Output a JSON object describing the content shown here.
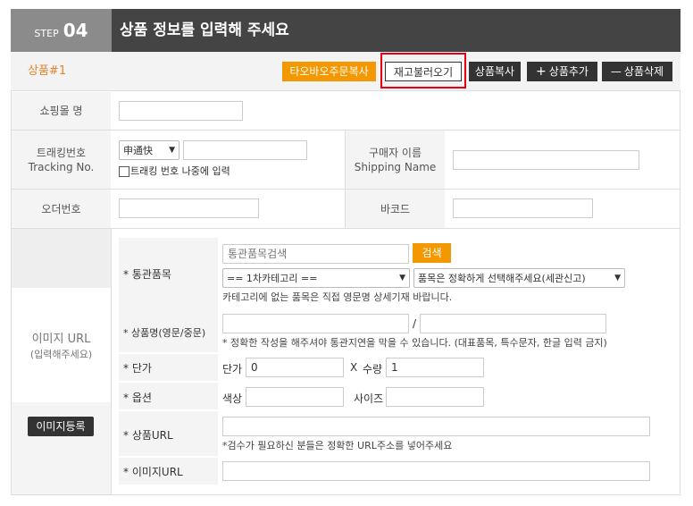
{
  "header": {
    "step_label": "STEP",
    "step_num": "04",
    "title": "상품 정보를 입력해 주세요"
  },
  "product": {
    "label": "상품#1",
    "buttons": {
      "taobao": "타오바오주문복사",
      "reload": "재고불러오기",
      "copy": "상품복사",
      "add": "상품추가",
      "delete": "상품삭제"
    },
    "add_icon": "+",
    "delete_icon": "—"
  },
  "form": {
    "mall_name": {
      "label": "쇼핑몰 명",
      "value": ""
    },
    "tracking": {
      "label_ko": "트래킹번호",
      "label_en": "Tracking No.",
      "carrier": "申通快",
      "value": "",
      "later_label": "트래킹 번호 나중에 입력"
    },
    "buyer": {
      "label_ko": "구매자 이름",
      "label_en": "Shipping Name",
      "value": ""
    },
    "order_no": {
      "label": "오더번호",
      "value": ""
    },
    "barcode": {
      "label": "바코드",
      "value": ""
    },
    "image_url": {
      "label": "이미지 URL",
      "sub_label": "(입력해주세요)",
      "register_button": "이미지등록"
    },
    "customs": {
      "label": "* 통관품목",
      "search_placeholder": "통관품목검색",
      "search_button": "검색",
      "category_select": "== 1차카테고리 ==",
      "item_select": "품목은 정확하게 선택해주세요(세관신고)",
      "note": "카테고리에 없는 품목은 직접 영문명 상세기재 바랍니다."
    },
    "product_name": {
      "label": "* 상품명(영문/중문)",
      "separator": "/",
      "note": "* 정확한 작성을 해주셔야 통관지연을 막을 수 있습니다. (대표품목, 특수문자, 한글 입력 금지)"
    },
    "unit_price": {
      "label": "* 단가",
      "price_label": "단가",
      "price_value": "0",
      "times": "X",
      "qty_label": "수량",
      "qty_value": "1"
    },
    "option": {
      "label": "* 옵션",
      "color_label": "색상",
      "size_label": "사이즈"
    },
    "product_url": {
      "label": "* 상품URL",
      "note": "*검수가 필요하신 분들은 정확한 URL주소를 넣어주세요"
    },
    "image_url_field": {
      "label": "* 이미지URL"
    }
  },
  "colors": {
    "accent_orange": "#f39800",
    "header_dark": "#444444",
    "highlight_red": "#e60012",
    "label_orange": "#e8832b"
  }
}
